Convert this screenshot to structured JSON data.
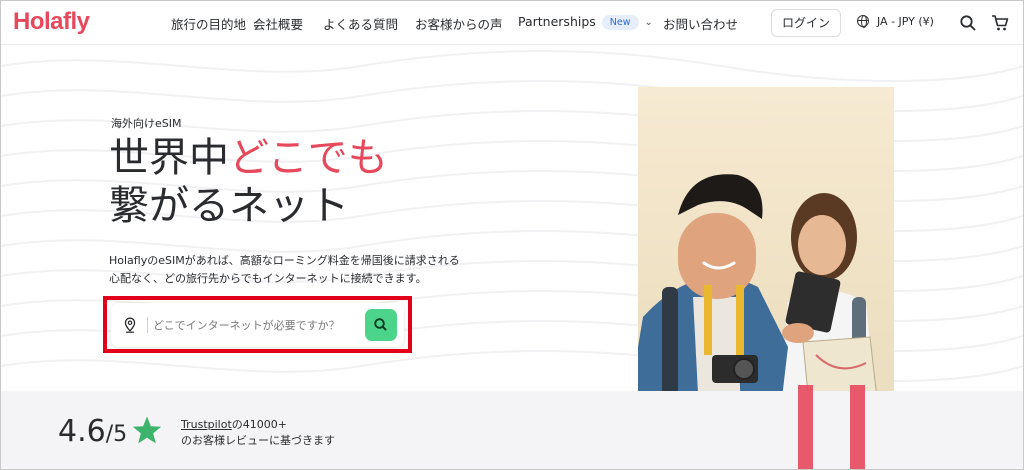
{
  "brand": {
    "logo_text": "Holafly",
    "accent_color": "#e6485c"
  },
  "nav": {
    "items": [
      {
        "label": "旅行の目的地",
        "has_chevron": true
      },
      {
        "label": "会社概要"
      },
      {
        "label": "よくある質問"
      },
      {
        "label": "お客様からの声"
      },
      {
        "label": "Partnerships",
        "badge": "New",
        "has_chevron": true
      },
      {
        "label": "お問い合わせ"
      }
    ],
    "login_label": "ログイン",
    "language_label": "JA - JPY (¥)",
    "icons": [
      "globe-icon",
      "search-icon",
      "cart-icon"
    ]
  },
  "hero": {
    "eyebrow": "海外向けeSIM",
    "headline_part1": "世界中",
    "headline_accent": "どこでも",
    "headline_line2": "繋がるネット",
    "description": "HolaflyのeSIMがあれば、高額なローミング料金を帰国後に請求される心配なく、どの旅行先からでもインターネットに接続できます。",
    "search_placeholder": "どこでインターネットが必要ですか？",
    "search_button_color": "#4cd58a",
    "highlight_color": "#e3001b"
  },
  "rating": {
    "score": "4.6",
    "out_of": "/5",
    "trustpilot_link": "Trustpilot",
    "reviews_count": "の41000+",
    "reviews_text": "のお客様レビューに基づきます",
    "star_color": "#3db36b"
  }
}
